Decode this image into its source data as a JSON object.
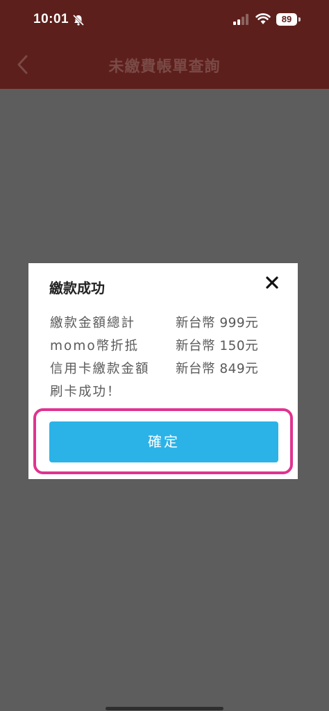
{
  "status_bar": {
    "time": "10:01",
    "battery": "89"
  },
  "nav": {
    "title": "未繳費帳單查詢"
  },
  "dialog": {
    "title": "繳款成功",
    "rows": [
      {
        "label": "繳款金額總計",
        "value": "新台幣 999元"
      },
      {
        "label": "momo幣折抵",
        "value": "新台幣 150元"
      },
      {
        "label": "信用卡繳款金額",
        "value": "新台幣 849元"
      },
      {
        "label": "刷卡成功！",
        "value": ""
      }
    ],
    "confirm_label": "確定"
  },
  "colors": {
    "header": "#5d1f1b",
    "overlay": "#5d5d5d",
    "button": "#2bb3e8",
    "highlight": "#e0338f"
  }
}
